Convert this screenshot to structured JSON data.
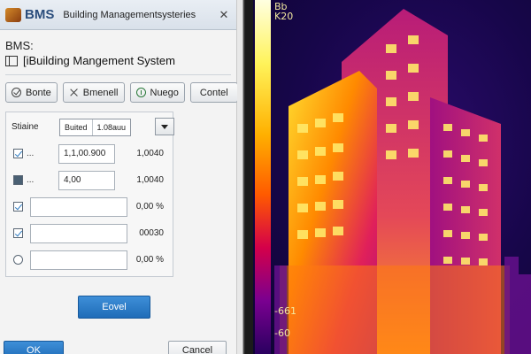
{
  "window": {
    "app_abbr": "BMS",
    "title": "Building Managementsysteries",
    "close_glyph": "✕"
  },
  "header": {
    "abbr": "BMS:",
    "system_name": "[iBuilding Mangement System"
  },
  "toolbar": [
    {
      "label": "Bonte",
      "icon": "check-circle-icon"
    },
    {
      "label": "Bmenell",
      "icon": "close-x-icon"
    },
    {
      "label": "Nuego",
      "icon": "info-circle-icon"
    },
    {
      "label": "Contel",
      "icon": ""
    }
  ],
  "panel": {
    "label": "Stiaine",
    "combo": {
      "left": "Buited",
      "right": "1.08auu"
    },
    "rows": [
      {
        "check": "checked",
        "dots": "...",
        "field": "1,1,00.900",
        "value": "1,0040"
      },
      {
        "check": "dark",
        "dots": "...",
        "field": "4,00",
        "value": "1,0040"
      },
      {
        "check": "checked",
        "dots": "",
        "field": "",
        "value": "0,00 %"
      },
      {
        "check": "checked",
        "dots": "",
        "field": "",
        "value": "00030"
      },
      {
        "check": "radio",
        "dots": "",
        "field": "",
        "value": "0,00 %"
      }
    ]
  },
  "buttons": {
    "primary": "Eovel",
    "ok": "OK",
    "cancel": "Cancel"
  },
  "thermal": {
    "scale_top": [
      "Bb",
      "K20"
    ],
    "scale_bottom": [
      "-661",
      "-60"
    ],
    "scale_colors": [
      "#ffffe0",
      "#fff35a",
      "#ffb000",
      "#ff5a00",
      "#d4004a",
      "#7a0090",
      "#2a0060"
    ]
  }
}
